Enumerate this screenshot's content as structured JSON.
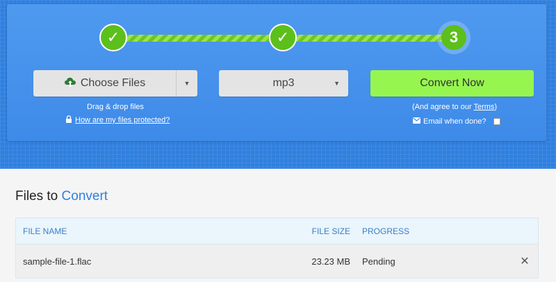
{
  "steps": [
    {
      "state": "done",
      "mark": "✓"
    },
    {
      "state": "done",
      "mark": "✓"
    },
    {
      "state": "current",
      "number": "3"
    }
  ],
  "controls": {
    "choose_label": "Choose Files",
    "format_value": "mp3",
    "convert_label": "Convert Now"
  },
  "hints": {
    "drag": "Drag & drop files",
    "protected_link": "How are my files protected?",
    "agree_prefix": "(And agree to our ",
    "terms_link": "Terms",
    "agree_suffix": ")",
    "email_label": "Email when done?"
  },
  "files": {
    "title_prefix": "Files to ",
    "title_accent": "Convert",
    "columns": {
      "name": "FILE NAME",
      "size": "FILE SIZE",
      "progress": "PROGRESS"
    },
    "rows": [
      {
        "name": "sample-file-1.flac",
        "size": "23.23 MB",
        "progress": "Pending"
      }
    ]
  },
  "colors": {
    "accent": "#2f80e0",
    "step_green": "#5cbf1b",
    "convert_button": "#97f54f"
  }
}
